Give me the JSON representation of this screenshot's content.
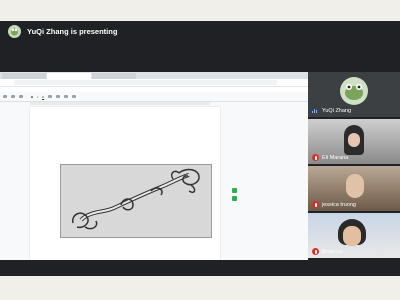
{
  "header": {
    "presenting_text": "YuQi Zhang is presenting"
  },
  "browser": {
    "tabs": [
      "",
      "",
      ""
    ],
    "url": "",
    "bookmarks": []
  },
  "doc": {
    "font_size": "",
    "side_text": ""
  },
  "participants": [
    {
      "name": "YuQi Zhang",
      "muted": false
    },
    {
      "name": "Eli Marana",
      "muted": true
    },
    {
      "name": "jessica truong",
      "muted": true
    },
    {
      "name": "Brian Lo",
      "muted": true
    }
  ],
  "colors": {
    "meeting_bg": "#202124",
    "mute_red": "#d93025",
    "voice_blue": "#8ab4f8"
  }
}
